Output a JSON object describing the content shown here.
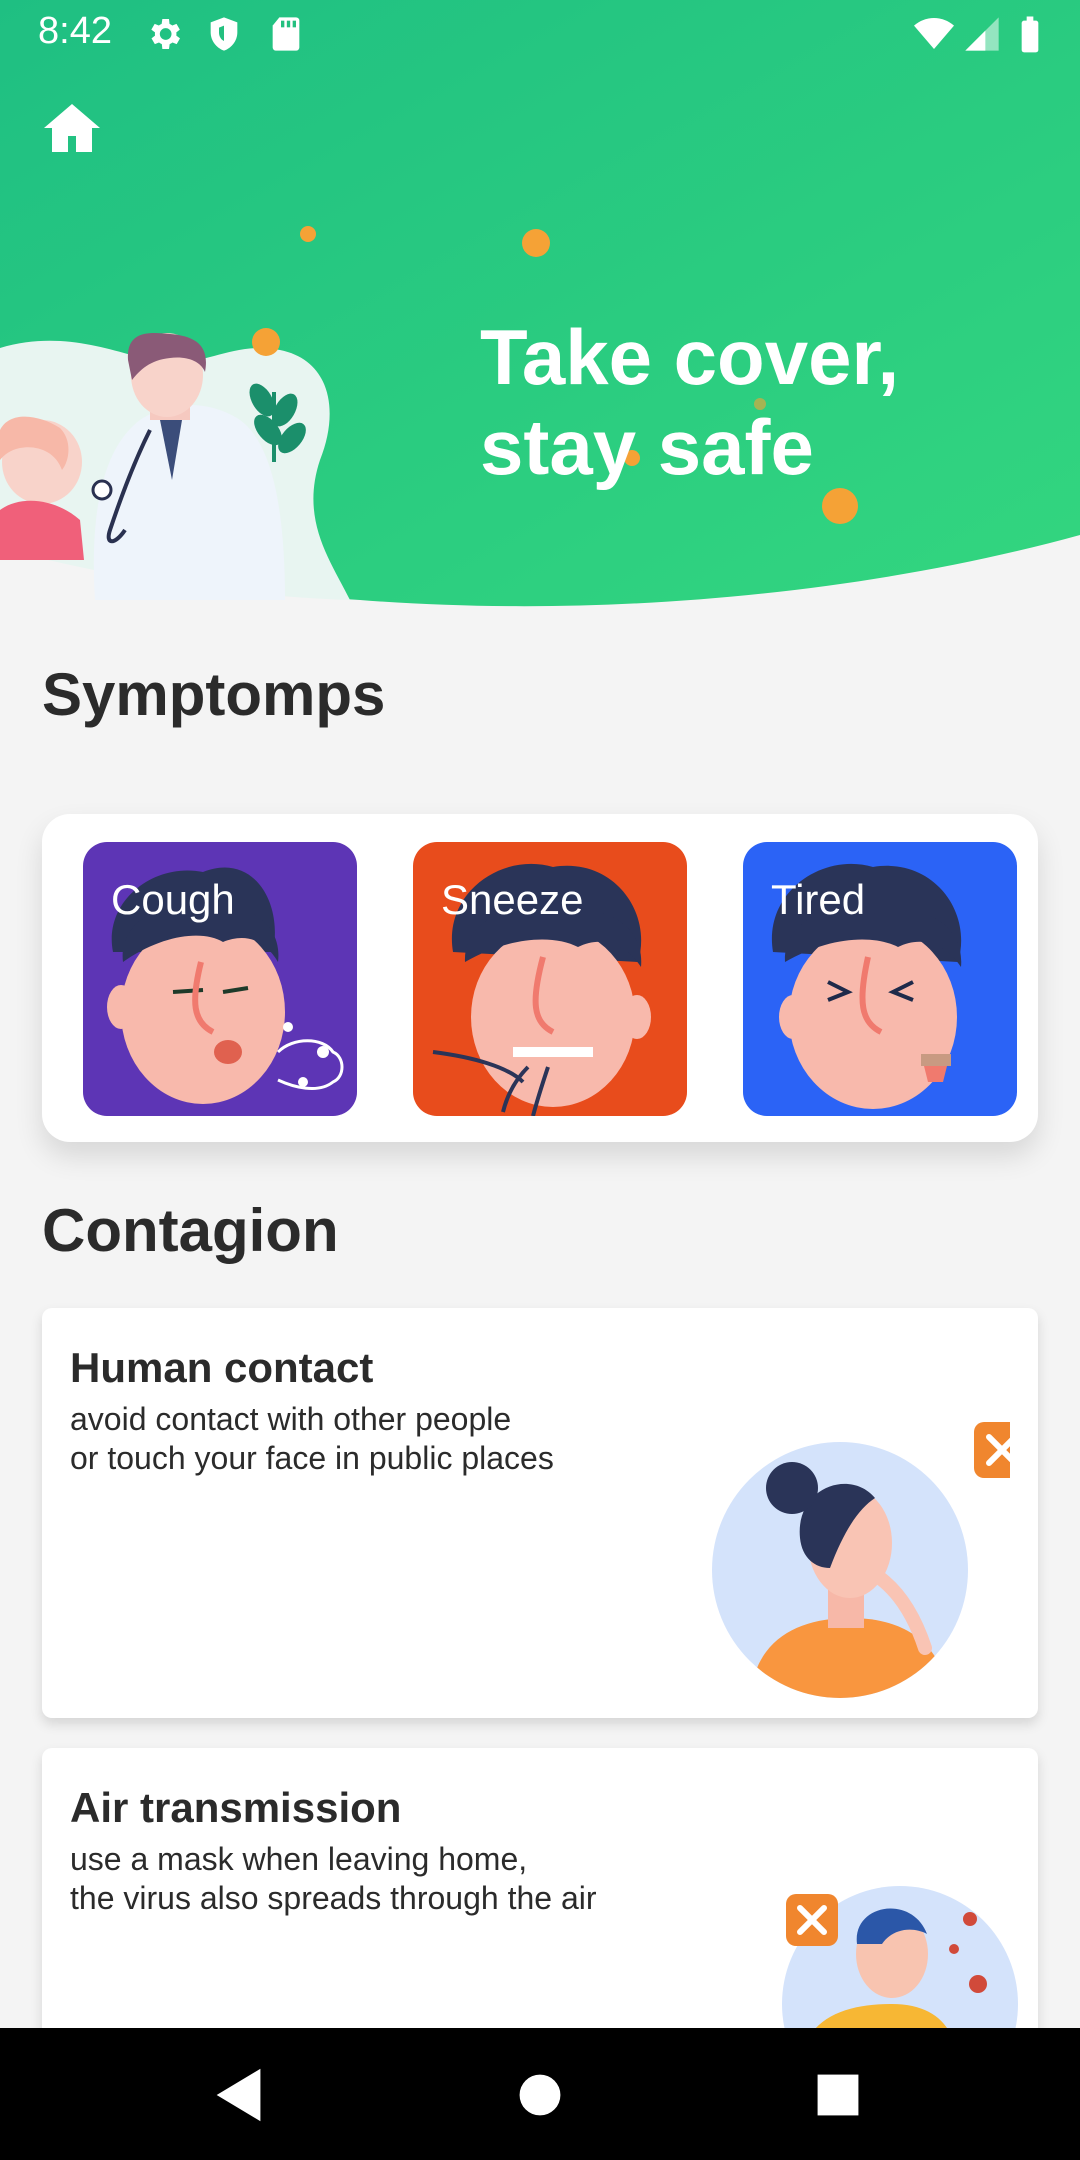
{
  "status_bar": {
    "time": "8:42",
    "left_icons": [
      "gear-icon",
      "shield-icon",
      "sd-card-icon"
    ],
    "right_icons": [
      "wifi-icon",
      "signal-icon",
      "battery-icon"
    ]
  },
  "hero": {
    "title_line1": "Take cover,",
    "title_line2": "stay safe",
    "gradient_from": "#1fbf82",
    "gradient_to": "#33d67f",
    "virus_color": "#f5a236"
  },
  "symptoms": {
    "heading": "Symptomps",
    "items": [
      {
        "label": "Cough",
        "color": "#5d35b5"
      },
      {
        "label": "Sneeze",
        "color": "#e84c1c"
      },
      {
        "label": "Tired",
        "color": "#2b63f6"
      }
    ]
  },
  "contagion": {
    "heading": "Contagion",
    "cards": [
      {
        "title": "Human contact",
        "line1": "avoid contact with other people",
        "line2": "or touch your face in public places"
      },
      {
        "title": "Air transmission",
        "line1": "use a mask when leaving home,",
        "line2": "the virus also spreads through the air"
      }
    ]
  },
  "nav_bar": {
    "buttons": [
      "back-icon",
      "home-circle-icon",
      "recents-icon"
    ]
  }
}
